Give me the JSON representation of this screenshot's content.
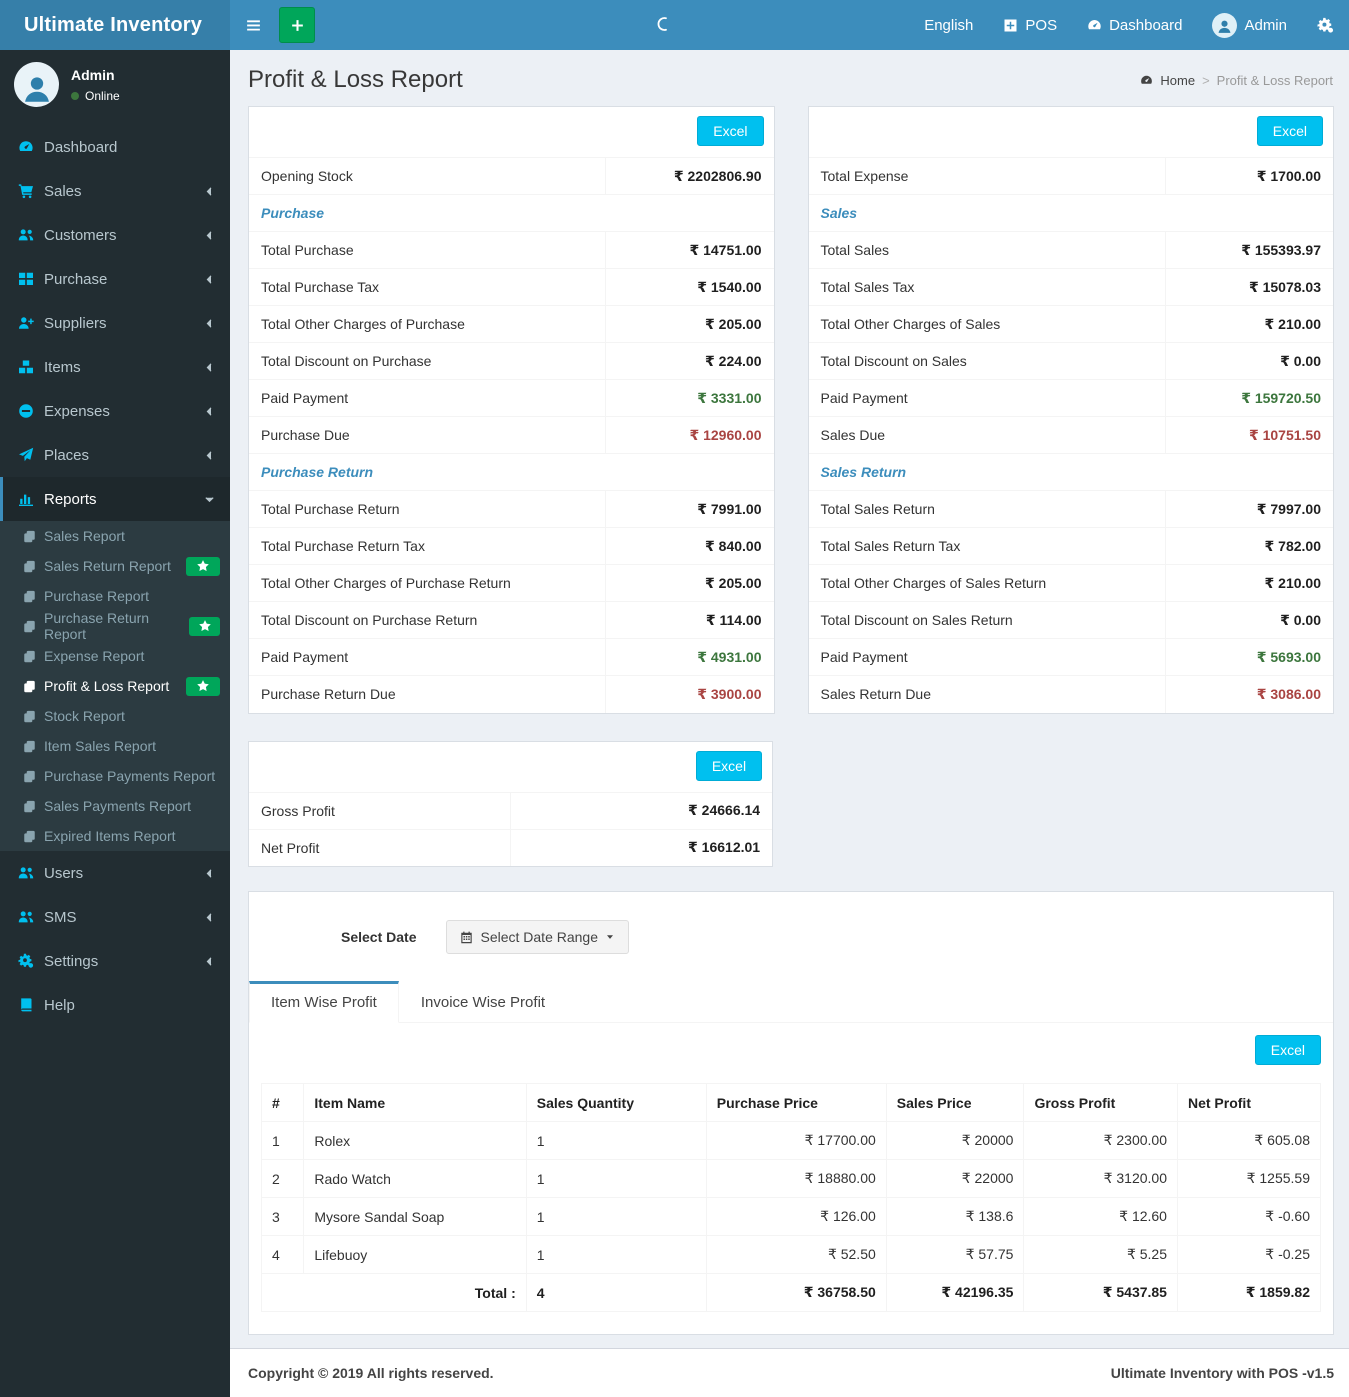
{
  "navbar": {
    "brand": "Ultimate Inventory",
    "language": "English",
    "pos_label": "POS",
    "dashboard_label": "Dashboard",
    "user_label": "Admin"
  },
  "sidebar": {
    "user": {
      "name": "Admin",
      "status": "Online"
    },
    "menu": [
      {
        "label": "Dashboard",
        "icon": "gauge-icon"
      },
      {
        "label": "Sales",
        "icon": "cart-icon",
        "chevron": true
      },
      {
        "label": "Customers",
        "icon": "users-icon",
        "chevron": true
      },
      {
        "label": "Purchase",
        "icon": "grid-icon",
        "chevron": true
      },
      {
        "label": "Suppliers",
        "icon": "user-plus-icon",
        "chevron": true
      },
      {
        "label": "Items",
        "icon": "cubes-icon",
        "chevron": true
      },
      {
        "label": "Expenses",
        "icon": "minus-circle-icon",
        "chevron": true
      },
      {
        "label": "Places",
        "icon": "paper-plane-icon",
        "chevron": true
      },
      {
        "label": "Reports",
        "icon": "chart-bar-icon",
        "active": true,
        "open": true,
        "children": [
          {
            "label": "Sales Report"
          },
          {
            "label": "Sales Return Report",
            "star": true
          },
          {
            "label": "Purchase Report"
          },
          {
            "label": "Purchase Return Report",
            "star": true
          },
          {
            "label": "Expense Report"
          },
          {
            "label": "Profit & Loss Report",
            "active": true,
            "star": true
          },
          {
            "label": "Stock Report"
          },
          {
            "label": "Item Sales Report"
          },
          {
            "label": "Purchase Payments Report"
          },
          {
            "label": "Sales Payments Report"
          },
          {
            "label": "Expired Items Report"
          }
        ]
      },
      {
        "label": "Users",
        "icon": "users-icon",
        "chevron": true
      },
      {
        "label": "SMS",
        "icon": "users-icon",
        "chevron": true
      },
      {
        "label": "Settings",
        "icon": "gears-icon",
        "chevron": true
      },
      {
        "label": "Help",
        "icon": "book-icon"
      }
    ]
  },
  "page": {
    "title": "Profit & Loss Report",
    "breadcrumb_home": "Home",
    "breadcrumb_sep": ">",
    "breadcrumb_current": "Profit & Loss Report"
  },
  "excel_label": "Excel",
  "purchase_box": {
    "rows": [
      {
        "label": "Opening Stock",
        "value": "₹ 2202806.90"
      },
      {
        "section": "Purchase"
      },
      {
        "label": "Total Purchase",
        "value": "₹ 14751.00"
      },
      {
        "label": "Total Purchase Tax",
        "value": "₹ 1540.00"
      },
      {
        "label": "Total Other Charges of Purchase",
        "value": "₹ 205.00"
      },
      {
        "label": "Total Discount on Purchase",
        "value": "₹ 224.00"
      },
      {
        "label": "Paid Payment",
        "value": "₹ 3331.00",
        "cls": "green"
      },
      {
        "label": "Purchase Due",
        "value": "₹ 12960.00",
        "cls": "red"
      },
      {
        "section": "Purchase Return"
      },
      {
        "label": "Total Purchase Return",
        "value": "₹ 7991.00"
      },
      {
        "label": "Total Purchase Return Tax",
        "value": "₹ 840.00"
      },
      {
        "label": "Total Other Charges of Purchase Return",
        "value": "₹ 205.00"
      },
      {
        "label": "Total Discount on Purchase Return",
        "value": "₹ 114.00"
      },
      {
        "label": "Paid Payment",
        "value": "₹ 4931.00",
        "cls": "green"
      },
      {
        "label": "Purchase Return Due",
        "value": "₹ 3900.00",
        "cls": "red"
      }
    ]
  },
  "sales_box": {
    "rows": [
      {
        "label": "Total Expense",
        "value": "₹ 1700.00"
      },
      {
        "section": "Sales"
      },
      {
        "label": "Total Sales",
        "value": "₹ 155393.97"
      },
      {
        "label": "Total Sales Tax",
        "value": "₹ 15078.03"
      },
      {
        "label": "Total Other Charges of Sales",
        "value": "₹ 210.00"
      },
      {
        "label": "Total Discount on Sales",
        "value": "₹ 0.00"
      },
      {
        "label": "Paid Payment",
        "value": "₹ 159720.50",
        "cls": "green"
      },
      {
        "label": "Sales Due",
        "value": "₹ 10751.50",
        "cls": "red"
      },
      {
        "section": "Sales Return"
      },
      {
        "label": "Total Sales Return",
        "value": "₹ 7997.00"
      },
      {
        "label": "Total Sales Return Tax",
        "value": "₹ 782.00"
      },
      {
        "label": "Total Other Charges of Sales Return",
        "value": "₹ 210.00"
      },
      {
        "label": "Total Discount on Sales Return",
        "value": "₹ 0.00"
      },
      {
        "label": "Paid Payment",
        "value": "₹ 5693.00",
        "cls": "green"
      },
      {
        "label": "Sales Return Due",
        "value": "₹ 3086.00",
        "cls": "red"
      }
    ]
  },
  "profit_box": {
    "rows": [
      {
        "label": "Gross Profit",
        "value": "₹ 24666.14"
      },
      {
        "label": "Net Profit",
        "value": "₹ 16612.01"
      }
    ]
  },
  "filter": {
    "label": "Select Date",
    "button_label": "Select Date Range"
  },
  "tabs": [
    {
      "label": "Item Wise Profit",
      "active": true
    },
    {
      "label": "Invoice Wise Profit"
    }
  ],
  "items_table": {
    "headers": [
      "#",
      "Item Name",
      "Sales Quantity",
      "Purchase Price",
      "Sales Price",
      "Gross Profit",
      "Net Profit"
    ],
    "rows": [
      {
        "sn": "1",
        "name": "Rolex",
        "qty": "1",
        "purchase": "₹ 17700.00",
        "sales": "₹ 20000",
        "gross": "₹ 2300.00",
        "net": "₹ 605.08"
      },
      {
        "sn": "2",
        "name": "Rado Watch",
        "qty": "1",
        "purchase": "₹ 18880.00",
        "sales": "₹ 22000",
        "gross": "₹ 3120.00",
        "net": "₹ 1255.59"
      },
      {
        "sn": "3",
        "name": "Mysore Sandal Soap",
        "qty": "1",
        "purchase": "₹ 126.00",
        "sales": "₹ 138.6",
        "gross": "₹ 12.60",
        "net": "₹ -0.60"
      },
      {
        "sn": "4",
        "name": "Lifebuoy",
        "qty": "1",
        "purchase": "₹ 52.50",
        "sales": "₹ 57.75",
        "gross": "₹ 5.25",
        "net": "₹ -0.25"
      }
    ],
    "total": {
      "label": "Total :",
      "qty": "4",
      "purchase": "₹ 36758.50",
      "sales": "₹ 42196.35",
      "gross": "₹ 5437.85",
      "net": "₹ 1859.82"
    }
  },
  "footer": {
    "left": "Copyright © 2019 All rights reserved.",
    "right": "Ultimate Inventory with POS -v1.5"
  },
  "colors": {
    "navbar": "#3c8dbc",
    "logo_bg": "#367fa9",
    "sidebar_bg": "#222d32",
    "submenu_bg": "#2c3b41",
    "sidebar_icon": "#00c0ef",
    "excel_button": "#00c0ef",
    "add_button": "#00a65a",
    "star_badge": "#00a65a",
    "positive_value": "#3c763d",
    "negative_value": "#a94442",
    "section_title": "#3c8dbc"
  }
}
